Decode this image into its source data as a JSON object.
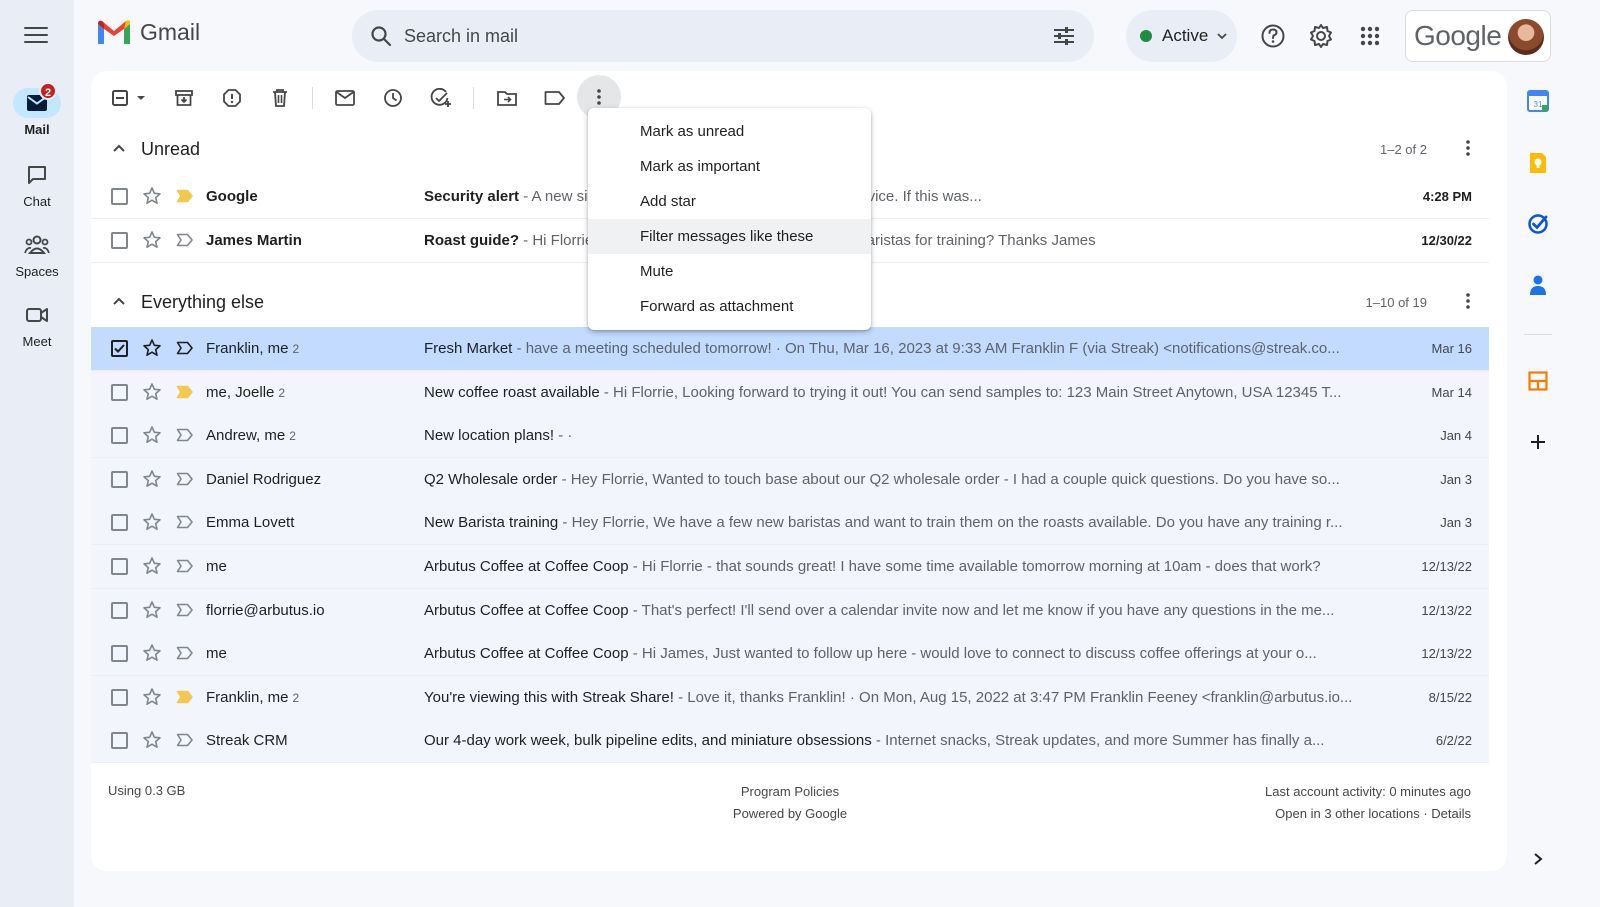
{
  "header": {
    "app_name": "Gmail",
    "search_placeholder": "Search in mail",
    "status_label": "Active",
    "account_brand": "Google"
  },
  "rail": {
    "items": [
      {
        "label": "Mail",
        "badge": "2"
      },
      {
        "label": "Chat"
      },
      {
        "label": "Spaces"
      },
      {
        "label": "Meet"
      }
    ]
  },
  "sections": {
    "unread": {
      "title": "Unread",
      "count": "1–2 of 2"
    },
    "everything_else": {
      "title": "Everything else",
      "count": "1–10 of 19"
    }
  },
  "unread_rows": [
    {
      "sender": "Google",
      "count": "",
      "subject": "Security alert",
      "snippet": " - A new sign-in to your Google Account on a Mac device. If this was...",
      "date": "4:28 PM",
      "important": true
    },
    {
      "sender": "James Martin",
      "count": "",
      "subject": "Roast guide?",
      "snippet": " - Hi Florrie, can you share the roast guide with my baristas for training? Thanks James",
      "date": "12/30/22",
      "important": false
    }
  ],
  "rows": [
    {
      "sender": "Franklin, me",
      "count": "2",
      "subject": "Fresh Market",
      "snippet": " - have a meeting scheduled tomorrow! · On Thu, Mar 16, 2023 at 9:33 AM Franklin F (via Streak) <notifications@streak.co...",
      "date": "Mar 16",
      "important": false,
      "selected": true
    },
    {
      "sender": "me, Joelle",
      "count": "2",
      "subject": "New coffee roast available",
      "snippet": " - Hi Florrie, Looking forward to trying it out! You can send samples to: 123 Main Street Anytown, USA 12345 T...",
      "date": "Mar 14",
      "important": true
    },
    {
      "sender": "Andrew, me",
      "count": "2",
      "subject": "New location plans!",
      "snippet": " - ·",
      "date": "Jan 4",
      "important": false
    },
    {
      "sender": "Daniel Rodriguez",
      "count": "",
      "subject": "Q2 Wholesale order",
      "snippet": " - Hey Florrie, Wanted to touch base about our Q2 wholesale order - I had a couple quick questions. Do you have so...",
      "date": "Jan 3",
      "important": false
    },
    {
      "sender": "Emma Lovett",
      "count": "",
      "subject": "New Barista training",
      "snippet": " - Hey Florrie, We have a few new baristas and want to train them on the roasts available. Do you have any training r...",
      "date": "Jan 3",
      "important": false
    },
    {
      "sender": "me",
      "count": "",
      "subject": "Arbutus Coffee at Coffee Coop",
      "snippet": " - Hi Florrie - that sounds great! I have some time available tomorrow morning at 10am - does that work?",
      "date": "12/13/22",
      "important": false
    },
    {
      "sender": "florrie@arbutus.io",
      "count": "",
      "subject": "Arbutus Coffee at Coffee Coop",
      "snippet": " - That's perfect! I'll send over a calendar invite now and let me know if you have any questions in the me...",
      "date": "12/13/22",
      "important": false
    },
    {
      "sender": "me",
      "count": "",
      "subject": "Arbutus Coffee at Coffee Coop",
      "snippet": " - Hi James, Just wanted to follow up here - would love to connect to discuss coffee offerings at your o...",
      "date": "12/13/22",
      "important": false
    },
    {
      "sender": "Franklin, me",
      "count": "2",
      "subject": "You're viewing this with Streak Share!",
      "snippet": " - Love it, thanks Franklin! · On Mon, Aug 15, 2022 at 3:47 PM Franklin Feeney <franklin@arbutus.io...",
      "date": "8/15/22",
      "important": true
    },
    {
      "sender": "Streak CRM",
      "count": "",
      "subject": "Our 4-day work week, bulk pipeline edits, and miniature obsessions",
      "snippet": " - Internet snacks, Streak updates, and more    Summer has finally a...",
      "date": "6/2/22",
      "important": false
    }
  ],
  "dropdown": {
    "items": [
      "Mark as unread",
      "Mark as important",
      "Add star",
      "Filter messages like these",
      "Mute",
      "Forward as attachment"
    ]
  },
  "footer": {
    "storage": "Using 0.3 GB",
    "policies": "Program Policies",
    "powered": "Powered by Google",
    "activity": "Last account activity: 0 minutes ago",
    "locations": "Open in 3 other locations · Details"
  },
  "colors": {
    "accent": "#0b57d0",
    "selected_row": "#c2dbff",
    "unread_bg": "#ffffff",
    "important_marker": "#f2c94c",
    "active_status": "#1e8e3e",
    "badge": "#c5221f"
  }
}
